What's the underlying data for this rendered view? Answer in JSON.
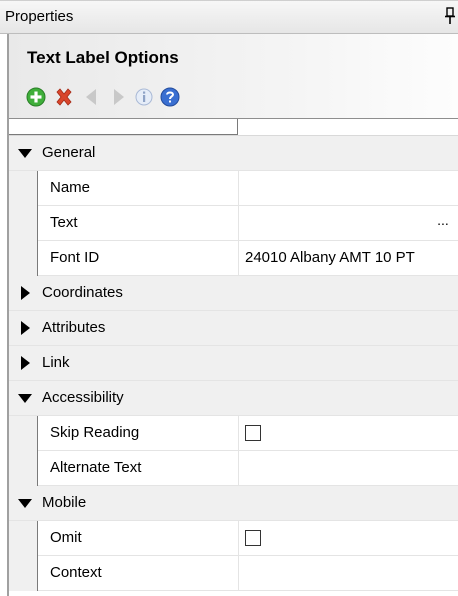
{
  "panel": {
    "title": "Properties"
  },
  "header": {
    "title": "Text Label Options"
  },
  "toolbar": {
    "buttons": [
      {
        "icon": "add-icon"
      },
      {
        "icon": "delete-icon"
      },
      {
        "icon": "back-icon"
      },
      {
        "icon": "forward-icon"
      },
      {
        "icon": "info-icon"
      },
      {
        "icon": "help-icon"
      }
    ]
  },
  "grid": {
    "general": {
      "label": "General",
      "expanded": true
    },
    "name": {
      "label": "Name",
      "value": ""
    },
    "text": {
      "label": "Text",
      "value": "",
      "button": "..."
    },
    "font_id": {
      "label": "Font ID",
      "value": "24010 Albany AMT 10 PT"
    },
    "coordinates": {
      "label": "Coordinates",
      "expanded": false
    },
    "attributes": {
      "label": "Attributes",
      "expanded": false
    },
    "link": {
      "label": "Link",
      "expanded": false
    },
    "accessibility": {
      "label": "Accessibility",
      "expanded": true
    },
    "skip_reading": {
      "label": "Skip Reading",
      "checked": false
    },
    "alternate_text": {
      "label": "Alternate Text",
      "value": ""
    },
    "mobile": {
      "label": "Mobile",
      "expanded": true
    },
    "omit": {
      "label": "Omit",
      "checked": false
    },
    "context": {
      "label": "Context",
      "value": ""
    }
  }
}
